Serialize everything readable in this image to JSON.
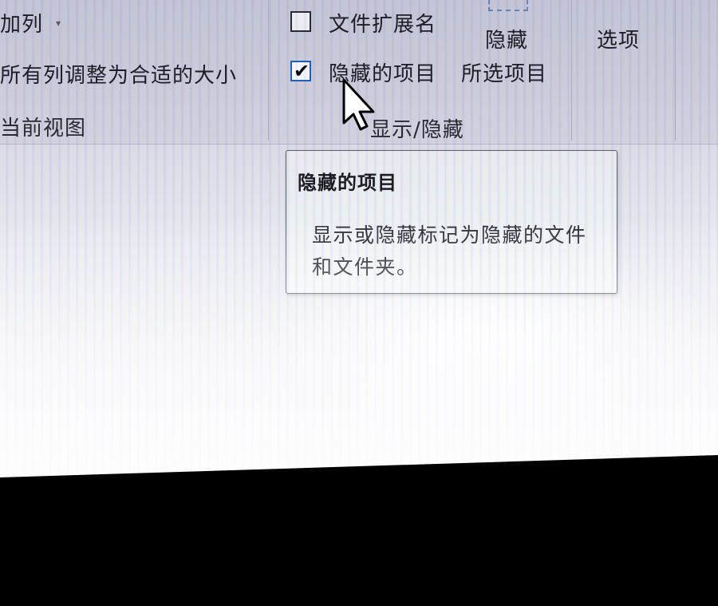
{
  "ribbon": {
    "add_column_label": "加列",
    "size_all_columns_label": "所有列调整为合适的大小",
    "current_view_group_label": "当前视图",
    "file_extensions_label": "文件扩展名",
    "file_extensions_checked": false,
    "hidden_items_label": "隐藏的项目",
    "hidden_items_checked": true,
    "hide_selected_label_top": "隐藏",
    "hide_selected_label_bottom": "所选项目",
    "show_hide_group_label": "显示/隐藏",
    "options_label": "选项"
  },
  "tooltip": {
    "title": "隐藏的项目",
    "description": "显示或隐藏标记为隐藏的文件和文件夹。"
  },
  "icons": {
    "checkmark": "✔",
    "caret": "▾"
  },
  "colors": {
    "ribbon_bg": "#c8c9d9",
    "checkbox_focus": "#1f5fb8",
    "tooltip_border": "#5b6270"
  }
}
